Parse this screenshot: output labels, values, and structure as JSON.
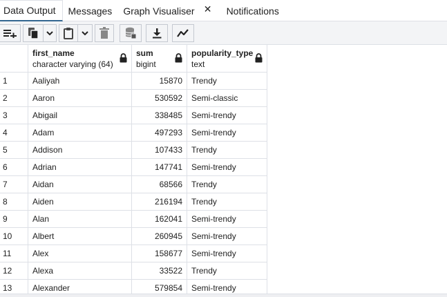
{
  "tabs": [
    {
      "label": "Data Output",
      "active": true
    },
    {
      "label": "Messages"
    },
    {
      "label": "Graph Visualiser",
      "closable": true,
      "close_glyph": "✕"
    },
    {
      "label": "Notifications"
    }
  ],
  "toolbar": {
    "buttons": [
      {
        "icon": "add-row-icon"
      },
      {
        "icon": "copy-icon"
      },
      {
        "icon": "chevron-down-icon"
      },
      {
        "icon": "paste-icon"
      },
      {
        "icon": "chevron-down-icon"
      },
      {
        "icon": "delete-icon"
      },
      {
        "icon": "save-data-icon"
      },
      {
        "icon": "download-icon"
      },
      {
        "icon": "graph-icon"
      }
    ]
  },
  "grid": {
    "columns": [
      {
        "name": "first_name",
        "type": "character varying (64)",
        "locked": true
      },
      {
        "name": "sum",
        "type": "bigint",
        "locked": true
      },
      {
        "name": "popularity_type",
        "type": "text",
        "locked": true
      }
    ],
    "rows": [
      {
        "n": "1",
        "first_name": "Aaliyah",
        "sum": "15870",
        "popularity_type": "Trendy"
      },
      {
        "n": "2",
        "first_name": "Aaron",
        "sum": "530592",
        "popularity_type": "Semi-classic"
      },
      {
        "n": "3",
        "first_name": "Abigail",
        "sum": "338485",
        "popularity_type": "Semi-trendy"
      },
      {
        "n": "4",
        "first_name": "Adam",
        "sum": "497293",
        "popularity_type": "Semi-trendy"
      },
      {
        "n": "5",
        "first_name": "Addison",
        "sum": "107433",
        "popularity_type": "Trendy"
      },
      {
        "n": "6",
        "first_name": "Adrian",
        "sum": "147741",
        "popularity_type": "Semi-trendy"
      },
      {
        "n": "7",
        "first_name": "Aidan",
        "sum": "68566",
        "popularity_type": "Trendy"
      },
      {
        "n": "8",
        "first_name": "Aiden",
        "sum": "216194",
        "popularity_type": "Trendy"
      },
      {
        "n": "9",
        "first_name": "Alan",
        "sum": "162041",
        "popularity_type": "Semi-trendy"
      },
      {
        "n": "10",
        "first_name": "Albert",
        "sum": "260945",
        "popularity_type": "Semi-trendy"
      },
      {
        "n": "11",
        "first_name": "Alex",
        "sum": "158677",
        "popularity_type": "Semi-trendy"
      },
      {
        "n": "12",
        "first_name": "Alexa",
        "sum": "33522",
        "popularity_type": "Trendy"
      },
      {
        "n": "13",
        "first_name": "Alexander",
        "sum": "579854",
        "popularity_type": "Semi-trendy"
      }
    ]
  },
  "colors": {
    "active_tab_underline": "#326690",
    "border": "#dde0e6",
    "toolbar_bg": "#f3f4f6"
  }
}
